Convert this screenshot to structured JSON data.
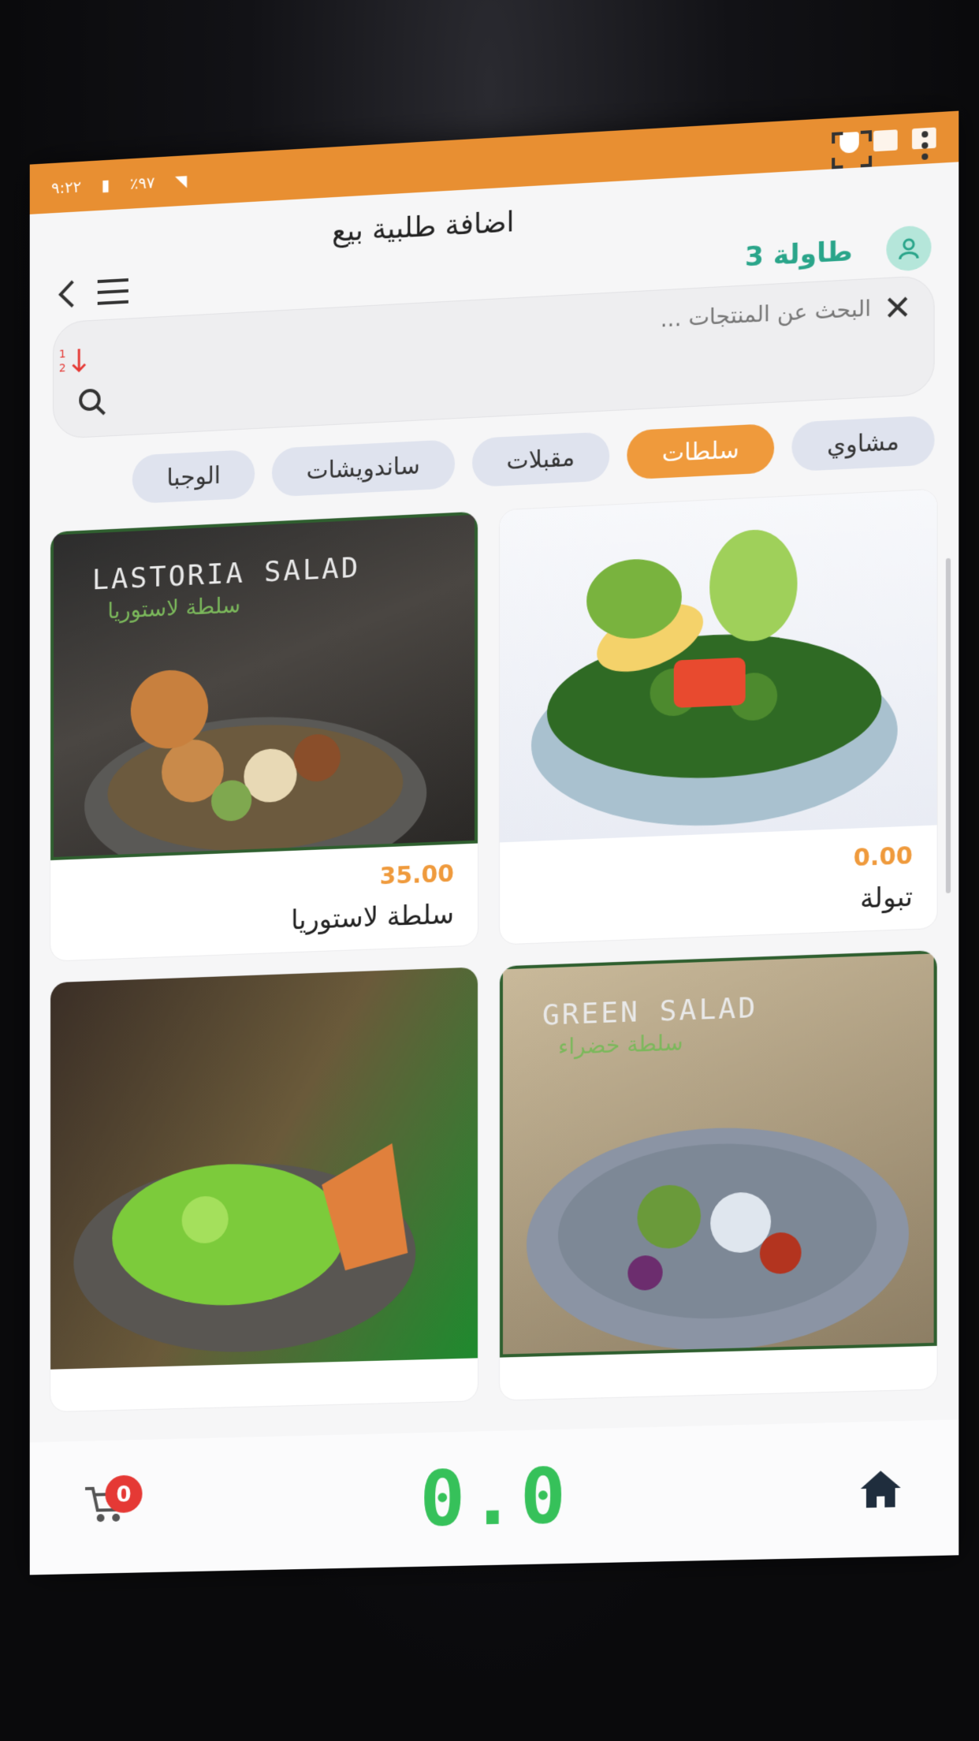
{
  "status_bar": {
    "time": "٩:٢٢",
    "battery": "٪٩٧"
  },
  "header": {
    "title": "اضافة طلبية بيع",
    "table_label": "طاولة 3"
  },
  "search": {
    "placeholder": "البحث عن المنتجات ..."
  },
  "categories": [
    {
      "label": "مشاوي",
      "active": false
    },
    {
      "label": "سلطات",
      "active": true
    },
    {
      "label": "مقبلات",
      "active": false
    },
    {
      "label": "ساندويشات",
      "active": false
    },
    {
      "label": "الوجبا",
      "active": false
    }
  ],
  "products": [
    {
      "name": "تبولة",
      "price": "0.00",
      "image_text": "",
      "image_text_ar": ""
    },
    {
      "name": "سلطة لاستوريا",
      "price": "35.00",
      "image_text": "LASTORIA SALAD",
      "image_text_ar": "سلطة لاستوريا"
    },
    {
      "name": "",
      "price": "",
      "image_text": "GREEN SALAD",
      "image_text_ar": "سلطة خضراء"
    },
    {
      "name": "",
      "price": "",
      "image_text": "",
      "image_text_ar": ""
    }
  ],
  "footer": {
    "total": "0.0",
    "cart_count": "0"
  },
  "colors": {
    "accent": "#ef9a3c",
    "status_bar": "#e88f32",
    "teal": "#2aa58a",
    "total_green": "#36c15a",
    "badge": "#e53935"
  }
}
